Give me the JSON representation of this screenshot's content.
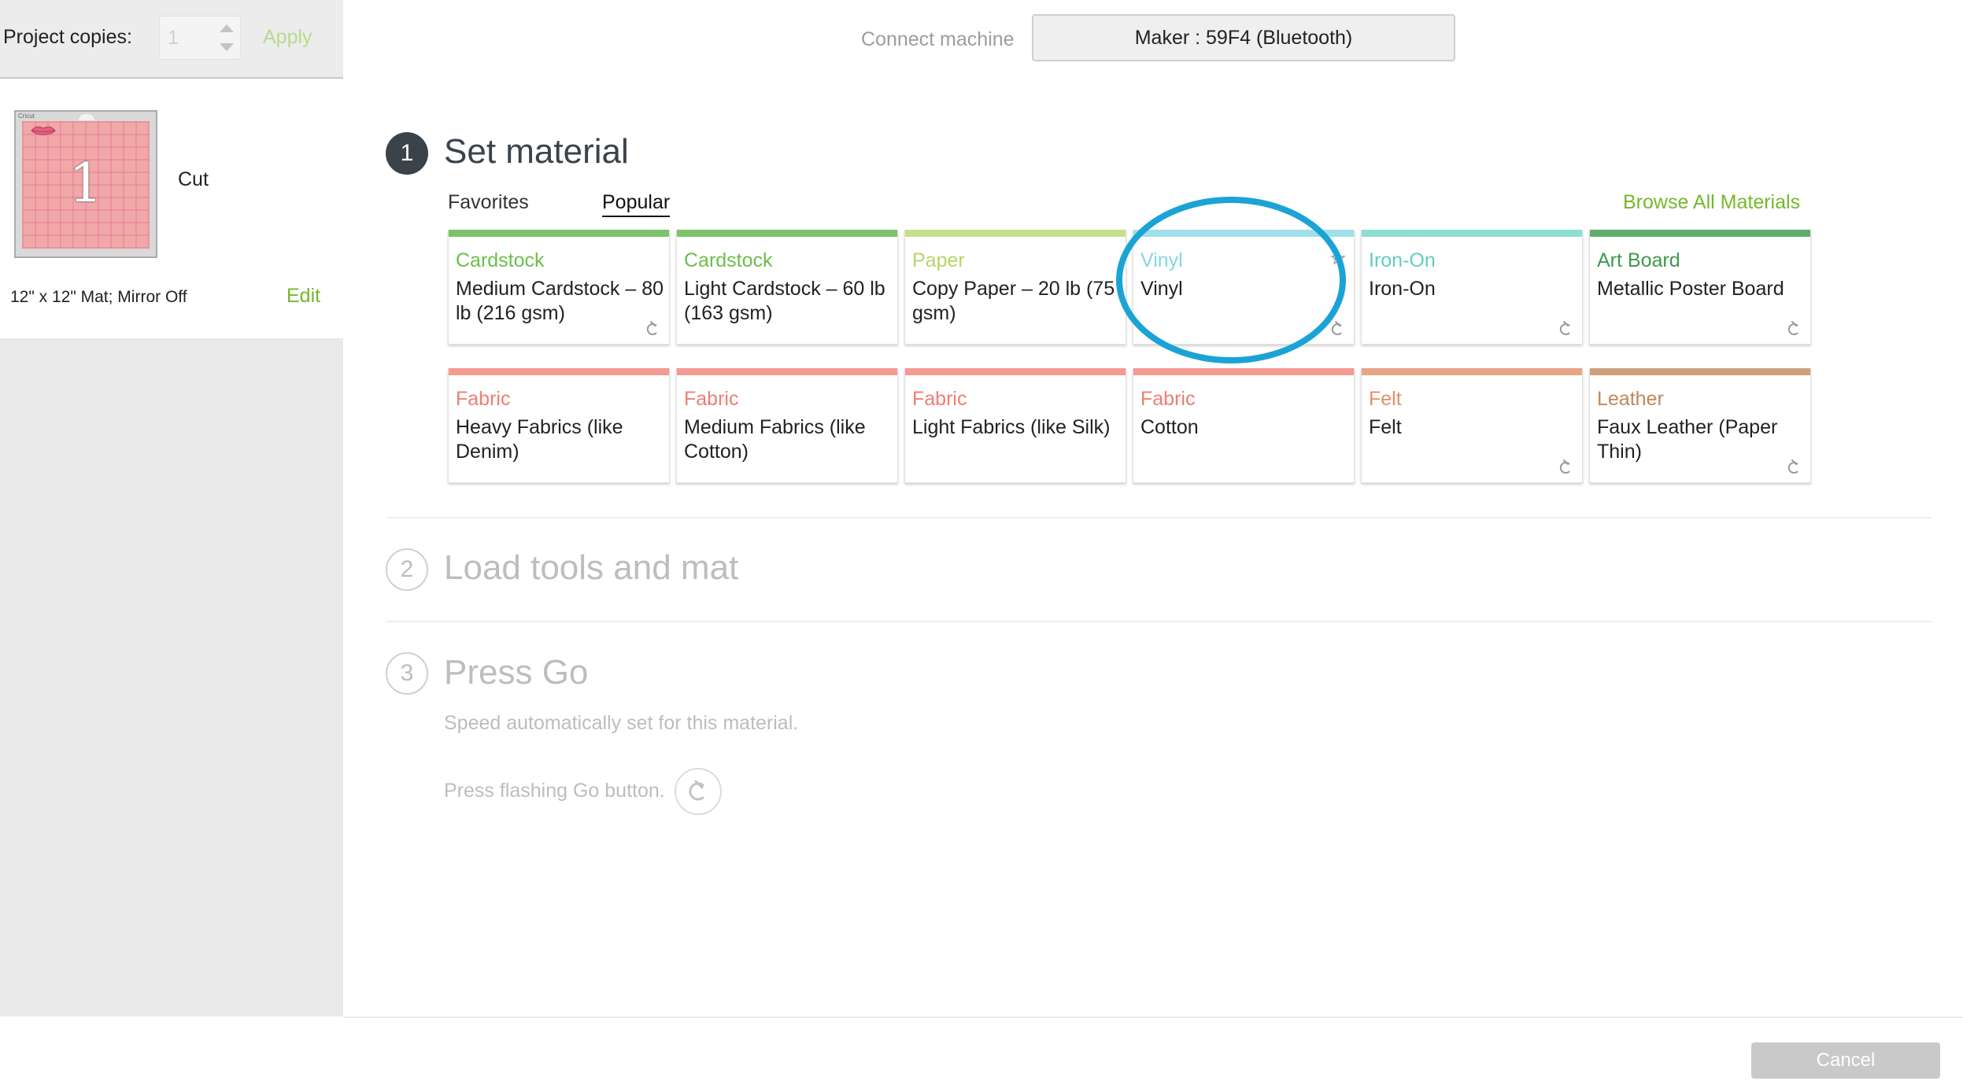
{
  "sidebar": {
    "copies_label": "Project copies:",
    "copies_value": "1",
    "apply_label": "Apply",
    "mat": {
      "number": "1",
      "brand": "Cricut",
      "action_label": "Cut",
      "info": "12\" x 12\" Mat; Mirror Off",
      "edit_label": "Edit"
    }
  },
  "header": {
    "connect_label": "Connect machine",
    "machine_value": "Maker : 59F4 (Bluetooth)"
  },
  "steps": [
    {
      "number": "1",
      "title": "Set material",
      "active": true
    },
    {
      "number": "2",
      "title": "Load tools and mat",
      "active": false
    },
    {
      "number": "3",
      "title": "Press Go",
      "active": false
    }
  ],
  "materials": {
    "tabs": [
      {
        "label": "Favorites",
        "selected": false
      },
      {
        "label": "Popular",
        "selected": true
      }
    ],
    "browse_all_label": "Browse All Materials",
    "cards": [
      {
        "category": "Cardstock",
        "name": "Medium Cardstock – 80 lb (216 gsm)",
        "color": "#7cc36a",
        "cat_color": "#6cbf4a",
        "icon": "cricut-c-icon"
      },
      {
        "category": "Cardstock",
        "name": "Light Cardstock – 60 lb (163 gsm)",
        "color": "#7cc36a",
        "cat_color": "#6cbf4a",
        "icon": ""
      },
      {
        "category": "Paper",
        "name": "Copy Paper – 20 lb (75 gsm)",
        "color": "#c5e08a",
        "cat_color": "#b5d56a",
        "icon": ""
      },
      {
        "category": "Vinyl",
        "name": "Vinyl",
        "color": "#9fe0ea",
        "cat_color": "#86d6e3",
        "icon": "cricut-c-icon",
        "star": true
      },
      {
        "category": "Iron-On",
        "name": "Iron-On",
        "color": "#8adfd2",
        "cat_color": "#5fcfbf",
        "icon": "cricut-c-icon"
      },
      {
        "category": "Art Board",
        "name": "Metallic Poster Board",
        "color": "#5fae6a",
        "cat_color": "#3e9a4c",
        "icon": "cricut-c-icon"
      },
      {
        "category": "Fabric",
        "name": "Heavy Fabrics (like Denim)",
        "color": "#f39a92",
        "cat_color": "#ef7d73",
        "icon": ""
      },
      {
        "category": "Fabric",
        "name": "Medium Fabrics (like Cotton)",
        "color": "#f39a92",
        "cat_color": "#ef7d73",
        "icon": ""
      },
      {
        "category": "Fabric",
        "name": "Light Fabrics (like Silk)",
        "color": "#f39a92",
        "cat_color": "#ef7d73",
        "icon": ""
      },
      {
        "category": "Fabric",
        "name": "Cotton",
        "color": "#f39a92",
        "cat_color": "#ef7d73",
        "icon": ""
      },
      {
        "category": "Felt",
        "name": "Felt",
        "color": "#e8a487",
        "cat_color": "#e58f69",
        "icon": "cricut-c-icon"
      },
      {
        "category": "Leather",
        "name": "Faux Leather (Paper Thin)",
        "color": "#cfa07c",
        "cat_color": "#c2865a",
        "icon": "cricut-c-icon"
      }
    ]
  },
  "press_go": {
    "speed_note": "Speed automatically set for this material.",
    "go_note": "Press flashing Go button."
  },
  "footer": {
    "cancel_label": "Cancel"
  },
  "colors": {
    "accent_green": "#76b82a",
    "highlight_blue": "#1ba3d6",
    "step_active": "#3b434a"
  }
}
